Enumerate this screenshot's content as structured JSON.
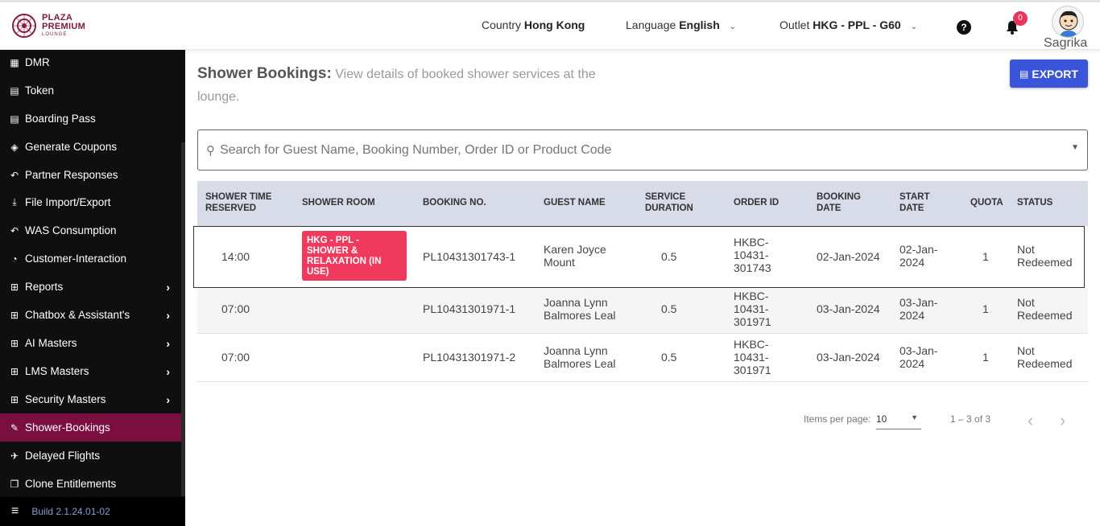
{
  "brand": {
    "line1": "PLAZA",
    "line2": "PREMIUM",
    "line3": "LOUNGE"
  },
  "header": {
    "country_label": "Country",
    "country_value": "Hong Kong",
    "language_label": "Language",
    "language_value": "English",
    "outlet_label": "Outlet",
    "outlet_value": "HKG - PPL - G60",
    "help_icon": "question-circle-icon",
    "notifications_count": "0",
    "username": "Sagrika"
  },
  "sidebar": {
    "items": [
      {
        "label": "DMR",
        "icon": "calendar-icon",
        "glyph": "▦"
      },
      {
        "label": "Token",
        "icon": "file-icon",
        "glyph": "▤"
      },
      {
        "label": "Boarding Pass",
        "icon": "file-icon",
        "glyph": "▤"
      },
      {
        "label": "Generate Coupons",
        "icon": "tag-icon",
        "glyph": "◈"
      },
      {
        "label": "Partner Responses",
        "icon": "reply-icon",
        "glyph": "↶"
      },
      {
        "label": "File Import/Export",
        "icon": "download-icon",
        "glyph": "⤓"
      },
      {
        "label": "WAS Consumption",
        "icon": "reply-icon",
        "glyph": "↶"
      },
      {
        "label": "Customer-Interaction",
        "icon": "chat-icon",
        "glyph": "◔"
      },
      {
        "label": "Reports",
        "icon": "sitemap-icon",
        "glyph": "⊞"
      },
      {
        "label": "Chatbox & Assistant's",
        "icon": "sitemap-icon",
        "glyph": "⊞"
      },
      {
        "label": "AI Masters",
        "icon": "sitemap-icon",
        "glyph": "⊞"
      },
      {
        "label": "LMS Masters",
        "icon": "sitemap-icon",
        "glyph": "⊞"
      },
      {
        "label": "Security Masters",
        "icon": "sitemap-icon",
        "glyph": "⊞"
      },
      {
        "label": "Shower-Bookings",
        "icon": "edit-icon",
        "glyph": "✎"
      },
      {
        "label": "Delayed Flights",
        "icon": "plane-icon",
        "glyph": "✈"
      },
      {
        "label": "Clone Entitlements",
        "icon": "copy-icon",
        "glyph": "❐"
      }
    ],
    "build": "Build 2.1.24.01-02"
  },
  "page": {
    "title": "Shower Bookings:",
    "subtitle": "View details of booked shower services at the lounge.",
    "export_label": "EXPORT",
    "search_placeholder": "Search for Guest Name, Booking Number, Order ID or Product Code"
  },
  "table": {
    "headers": {
      "time": "SHOWER TIME RESERVED",
      "room": "SHOWER ROOM",
      "booking": "BOOKING NO.",
      "guest": "GUEST NAME",
      "duration": "SERVICE DURATION",
      "order": "ORDER ID",
      "bdate": "BOOKING DATE",
      "sdate": "START DATE",
      "quota": "QUOTA",
      "status": "STATUS"
    },
    "rows": [
      {
        "time": "14:00",
        "room": "HKG - PPL - SHOWER & RELAXATION (IN USE)",
        "booking": "PL10431301743-1",
        "guest": "Karen Joyce Mount",
        "duration": "0.5",
        "order": "HKBC-10431-301743",
        "bdate": "02-Jan-2024",
        "sdate": "02-Jan-2024",
        "quota": "1",
        "status": "Not Redeemed"
      },
      {
        "time": "07:00",
        "room": "",
        "booking": "PL10431301971-1",
        "guest": "Joanna Lynn Balmores Leal",
        "duration": "0.5",
        "order": "HKBC-10431-301971",
        "bdate": "03-Jan-2024",
        "sdate": "03-Jan-2024",
        "quota": "1",
        "status": "Not Redeemed"
      },
      {
        "time": "07:00",
        "room": "",
        "booking": "PL10431301971-2",
        "guest": "Joanna Lynn Balmores Leal",
        "duration": "0.5",
        "order": "HKBC-10431-301971",
        "bdate": "03-Jan-2024",
        "sdate": "03-Jan-2024",
        "quota": "1",
        "status": "Not Redeemed"
      }
    ]
  },
  "pagination": {
    "items_per_page_label": "Items per page:",
    "items_per_page_value": "10",
    "range": "1 – 3 of 3"
  },
  "colors": {
    "active": "#7a0f3f",
    "accent": "#3a55d9",
    "badge": "#ef3a5d"
  }
}
